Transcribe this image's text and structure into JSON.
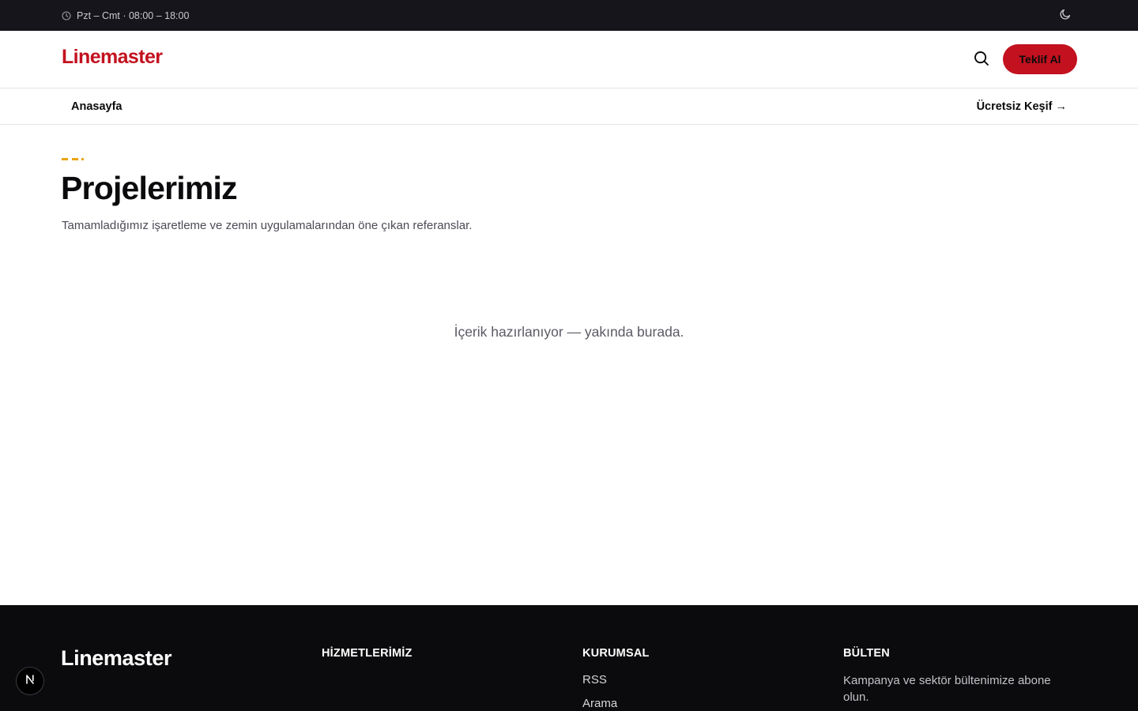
{
  "topbar": {
    "hours": "Pzt – Cmt · 08:00 – 18:00",
    "icons": {
      "hours": "clock-icon",
      "theme": "moon-icon"
    }
  },
  "header": {
    "logo": "Linemaster",
    "cta_label": "Teklif Al",
    "icons": {
      "search": "search-icon"
    },
    "colors": {
      "brand": "#c3111f",
      "accent": "#e8a412"
    }
  },
  "nav": {
    "home": "Anasayfa",
    "discover": "Ücretsiz Keşif →"
  },
  "main": {
    "title": "Projelerimiz",
    "subtitle": "Tamamladığımız işaretleme ve zemin uygulamalarından öne çıkan referanslar.",
    "empty_message": "İçerik hazırlanıyor — yakında burada."
  },
  "footer": {
    "logo": "Linemaster",
    "columns": [
      {
        "title": "HİZMETLERİMİZ",
        "links": []
      },
      {
        "title": "KURUMSAL",
        "links": [
          "RSS",
          "Arama"
        ]
      },
      {
        "title": "BÜLTEN",
        "text": "Kampanya ve sektör bültenimize abone olun."
      }
    ]
  },
  "dev_badge": {
    "letter": "N"
  }
}
